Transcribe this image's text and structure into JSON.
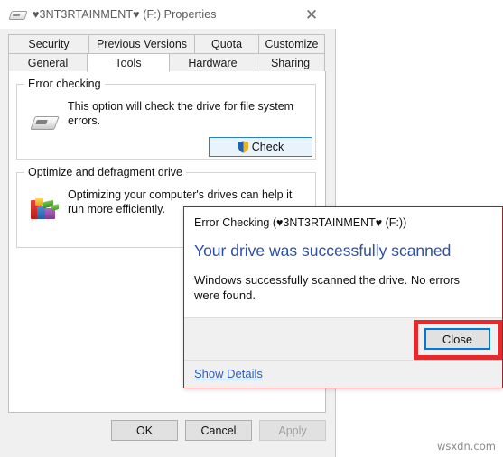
{
  "window": {
    "title": "♥3NT3RTAINMENT♥ (F:) Properties",
    "icon": "drive-icon",
    "close_label": "✕"
  },
  "tabs": {
    "row1": [
      {
        "label": "Security",
        "active": false
      },
      {
        "label": "Previous Versions",
        "active": false
      },
      {
        "label": "Quota",
        "active": false
      },
      {
        "label": "Customize",
        "active": false
      }
    ],
    "row2": [
      {
        "label": "General",
        "active": false
      },
      {
        "label": "Tools",
        "active": true
      },
      {
        "label": "Hardware",
        "active": false
      },
      {
        "label": "Sharing",
        "active": false
      }
    ]
  },
  "groups": {
    "error_checking": {
      "label": "Error checking",
      "icon": "drive-icon",
      "description": "This option will check the drive for file system errors.",
      "button": {
        "label": "Check",
        "icon": "uac-shield-icon"
      }
    },
    "optimize": {
      "label": "Optimize and defragment drive",
      "icon": "defrag-icon",
      "description": "Optimizing your computer's drives can help it run more efficiently."
    }
  },
  "footer_buttons": {
    "ok": "OK",
    "cancel": "Cancel",
    "apply": "Apply"
  },
  "error_dialog": {
    "title": "Error Checking (♥3NT3RTAINMENT♥ (F:))",
    "heading": "Your drive was successfully scanned",
    "body": "Windows successfully scanned the drive. No errors were found.",
    "close_label": "Close",
    "show_details": "Show Details",
    "heading_color": "#2c50a8",
    "highlight_color": "#e8282a",
    "focus_color": "#0078d7"
  },
  "watermark": "wsxdn.com"
}
